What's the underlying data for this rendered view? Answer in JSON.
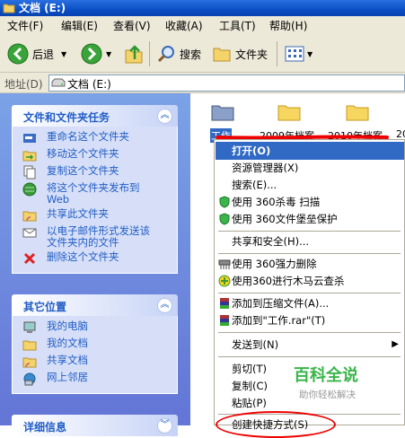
{
  "window": {
    "title": "文档 (E:)"
  },
  "menubar": {
    "items": [
      "文件(F)",
      "编辑(E)",
      "查看(V)",
      "收藏(A)",
      "工具(T)",
      "帮助(H)"
    ]
  },
  "toolbar": {
    "back": "后退",
    "search": "搜索",
    "folders": "文件夹"
  },
  "address": {
    "label": "地址(D)",
    "value": "文档 (E:)"
  },
  "tasks_panel": {
    "title": "文件和文件夹任务",
    "items": [
      {
        "label": "重命名这个文件夹",
        "icon": "rename-icon"
      },
      {
        "label": "移动这个文件夹",
        "icon": "move-icon"
      },
      {
        "label": "复制这个文件夹",
        "icon": "copy-icon"
      },
      {
        "label": "将这个文件夹发布到",
        "label2": "Web",
        "icon": "publish-web-icon"
      },
      {
        "label": "共享此文件夹",
        "icon": "share-icon"
      },
      {
        "label": "以电子邮件形式发送该",
        "label2": "文件夹内的文件",
        "icon": "email-icon"
      },
      {
        "label": "删除这个文件夹",
        "icon": "delete-icon"
      }
    ]
  },
  "places_panel": {
    "title": "其它位置",
    "items": [
      {
        "label": "我的电脑",
        "icon": "my-computer-icon"
      },
      {
        "label": "我的文档",
        "icon": "my-documents-icon"
      },
      {
        "label": "共享文档",
        "icon": "shared-documents-icon"
      },
      {
        "label": "网上邻居",
        "icon": "network-icon"
      }
    ]
  },
  "details_panel": {
    "title": "详细信息"
  },
  "folders": [
    {
      "label": "工作"
    },
    {
      "label": "2009年档案"
    },
    {
      "label": "2010年档案"
    },
    {
      "label": "20"
    }
  ],
  "context_menu": {
    "items": [
      {
        "label": "打开(O)"
      },
      {
        "label": "资源管理器(X)"
      },
      {
        "label": "搜索(E)..."
      },
      {
        "label": "使用 360杀毒 扫描"
      },
      {
        "label": "使用 360文件堡垒保护"
      },
      {
        "label": "共享和安全(H)..."
      },
      {
        "label": "使用 360强力删除"
      },
      {
        "label": "使用360进行木马云查杀"
      },
      {
        "label": "添加到压缩文件(A)..."
      },
      {
        "label": "添加到\"工作.rar\"(T)"
      },
      {
        "label": "发送到(N)"
      },
      {
        "label": "剪切(T)"
      },
      {
        "label": "复制(C)"
      },
      {
        "label": "粘贴(P)"
      },
      {
        "label": "创建快捷方式(S)"
      }
    ]
  },
  "watermark": {
    "line1": "百科全说",
    "line2": "助你轻松解决"
  },
  "colors": {
    "accent": "#316ac5",
    "panel_link": "#215dc6",
    "annotation": "#ee0000",
    "watermark": "#39b54a"
  }
}
